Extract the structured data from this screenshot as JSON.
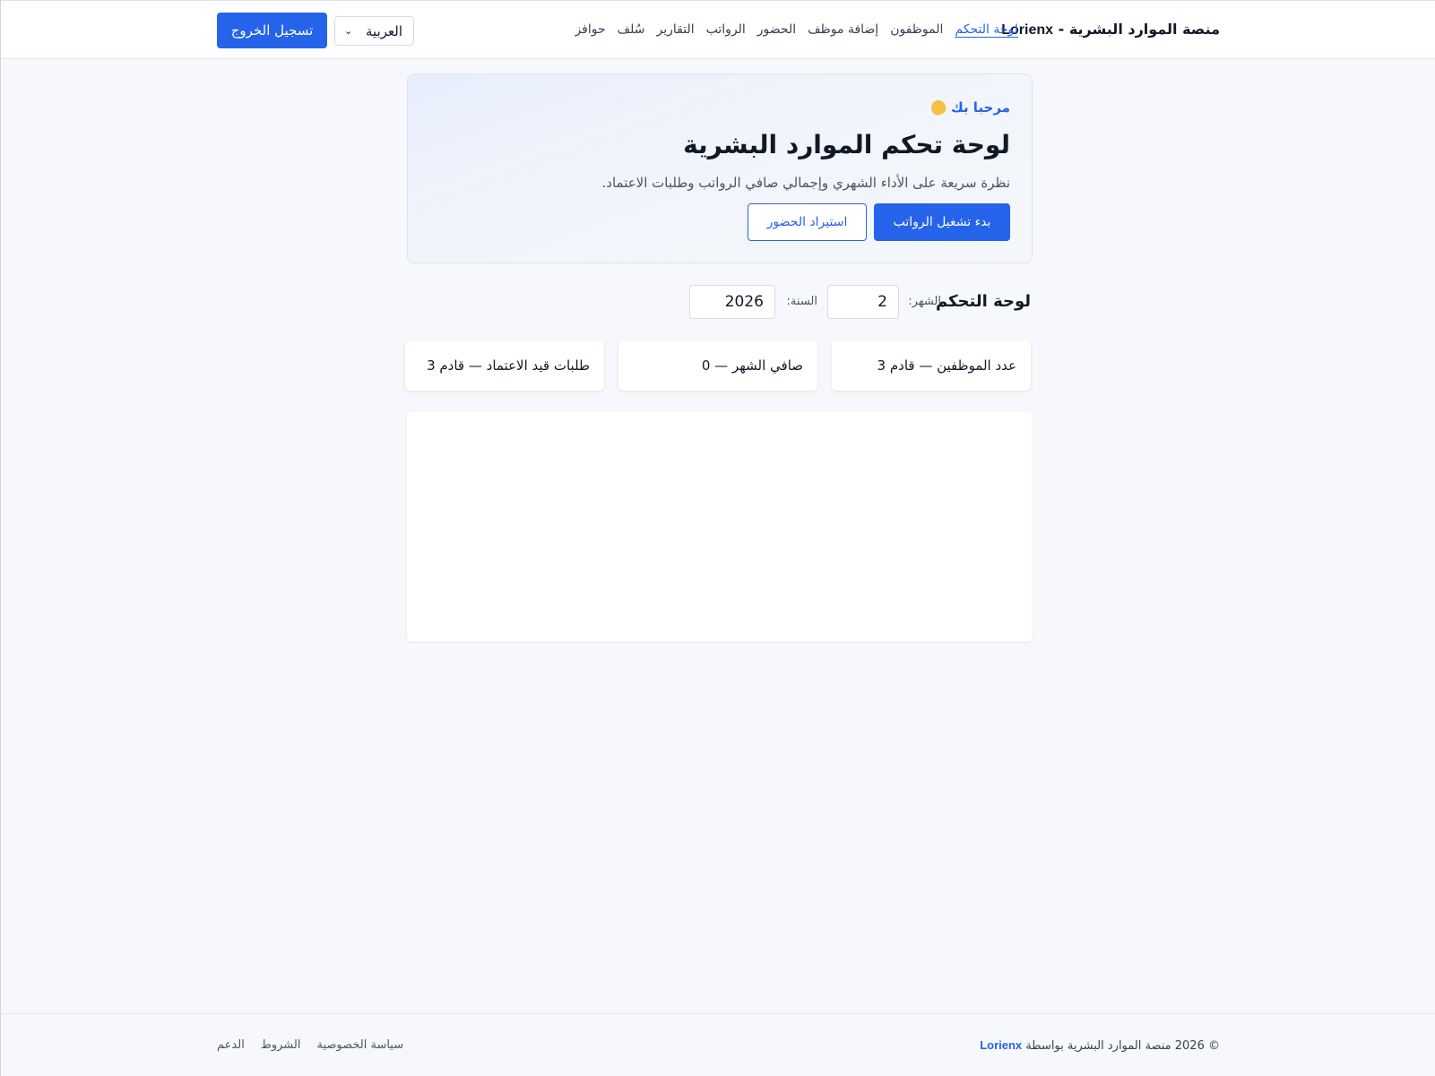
{
  "header": {
    "brand_ar": "منصة الموارد البشرية - ",
    "brand_latin": "Lorienx",
    "nav": [
      {
        "label": "لوحة التحكم",
        "active": true
      },
      {
        "label": "الموظفون",
        "active": false
      },
      {
        "label": "إضافة موظف",
        "active": false
      },
      {
        "label": "الحضور",
        "active": false
      },
      {
        "label": "الرواتب",
        "active": false
      },
      {
        "label": "التقارير",
        "active": false
      },
      {
        "label": "سُلف",
        "active": false
      },
      {
        "label": "حوافز",
        "active": false
      }
    ],
    "language": "العربية",
    "logout_label": "تسجيل الخروج"
  },
  "hero": {
    "welcome": "مرحبا بك",
    "welcome_icon": "waving-hand-icon",
    "title": "لوحة تحكم الموارد البشرية",
    "subtitle": "نظرة سريعة على الأداء الشهري وإجمالي صافي الرواتب وطلبات الاعتماد.",
    "primary_button": "بدء تشغيل الرواتب",
    "secondary_button": "استيراد الحضور"
  },
  "filters": {
    "section_title": "لوحة التحكم",
    "month_label": "الشهر:",
    "month_value": "2",
    "year_label": "السنة:",
    "year_value": "2026"
  },
  "stats": [
    {
      "label": "عدد الموظفين — قادم 3"
    },
    {
      "label": "صافي الشهر — 0"
    },
    {
      "label": "طلبات قيد الاعتماد — قادم 3"
    }
  ],
  "footer": {
    "copyright_prefix": "© 2026 منصة الموارد البشرية بواسطة ",
    "copyright_brand": "Lorienx",
    "links": [
      "سياسة الخصوصية",
      "الشروط",
      "الدعم"
    ]
  },
  "colors": {
    "accent": "#2563eb",
    "background": "#f6f8fb",
    "surface": "#ffffff"
  }
}
